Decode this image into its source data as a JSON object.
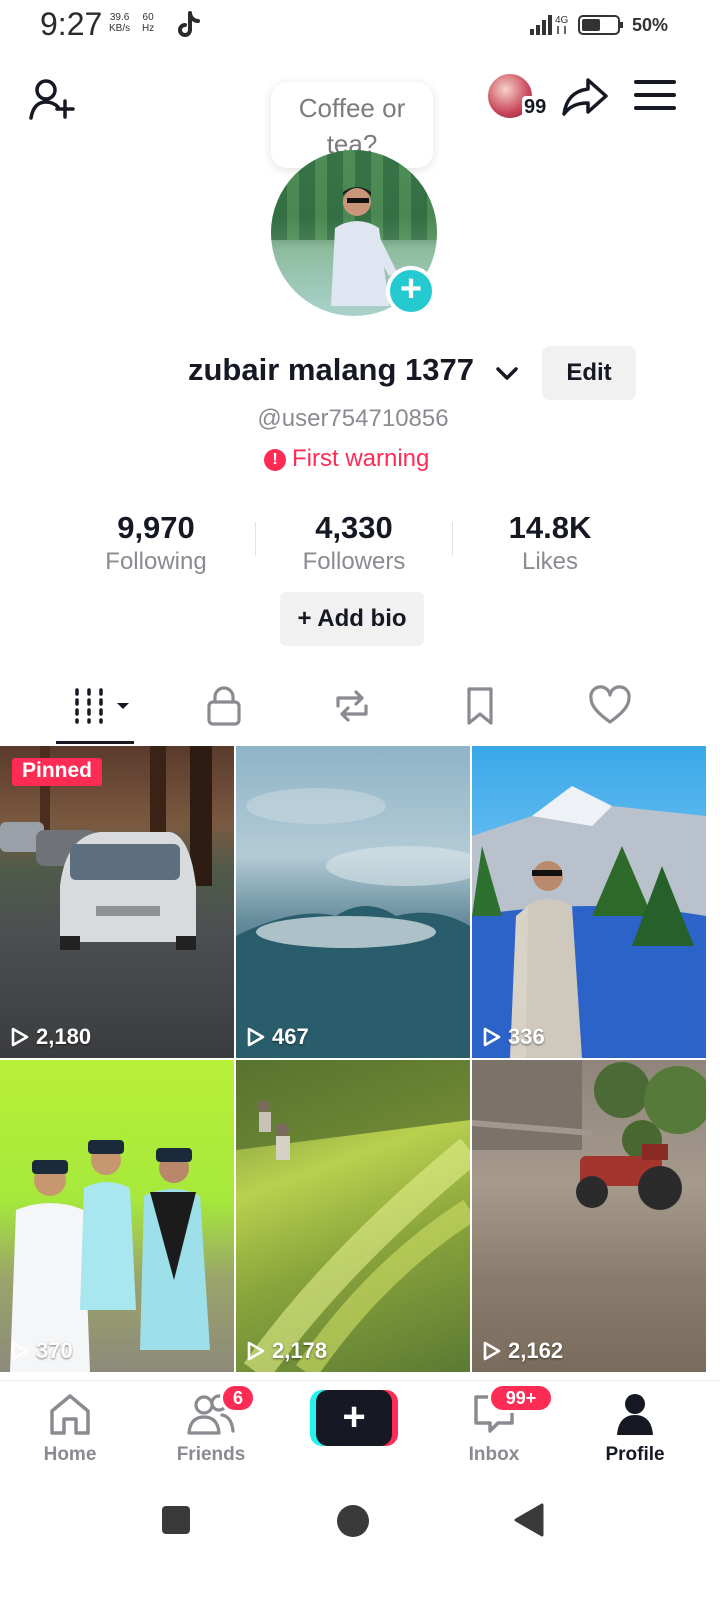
{
  "status_bar": {
    "time": "9:27",
    "net_speed_value": "39.6",
    "net_speed_unit": "KB/s",
    "refresh_value": "60",
    "refresh_unit": "Hz",
    "network_type": "4G",
    "battery": "50%"
  },
  "header": {
    "bubble_text": "Coffee or tea?",
    "visitor_count": "99"
  },
  "profile": {
    "display_name": "zubair malang 1377",
    "edit_label": "Edit",
    "handle": "@user754710856",
    "warning": "First warning",
    "add_bio_label": "+ Add bio"
  },
  "stats": [
    {
      "value": "9,970",
      "label": "Following"
    },
    {
      "value": "4,330",
      "label": "Followers"
    },
    {
      "value": "14.8K",
      "label": "Likes"
    }
  ],
  "tabs": [
    "videos-grid-icon",
    "lock-icon",
    "repost-icon",
    "bookmark-icon",
    "heart-icon"
  ],
  "videos": [
    {
      "views": "2,180",
      "pinned_label": "Pinned"
    },
    {
      "views": "467"
    },
    {
      "views": "336"
    },
    {
      "views": "370"
    },
    {
      "views": "2,178"
    },
    {
      "views": "2,162"
    }
  ],
  "bottom_nav": {
    "home": "Home",
    "friends": "Friends",
    "friends_badge": "6",
    "inbox": "Inbox",
    "inbox_badge": "99+",
    "profile": "Profile",
    "create": "+"
  },
  "colors": {
    "accent_red": "#fe2c55",
    "accent_cyan": "#25f4ee",
    "text_dark": "#161823",
    "text_gray": "#8a8b91"
  }
}
